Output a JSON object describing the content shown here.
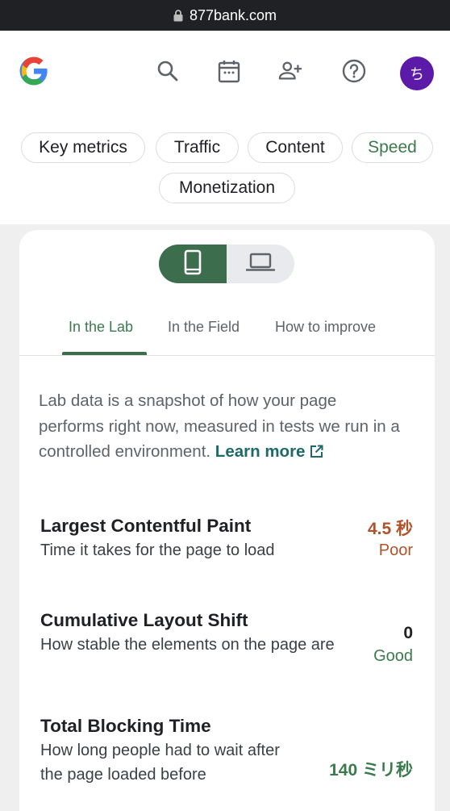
{
  "browser": {
    "url": "877bank.com",
    "lock_icon": "lock-icon"
  },
  "header": {
    "logo": "google-logo",
    "icons": [
      "search-icon",
      "calendar-icon",
      "add-person-icon",
      "help-icon"
    ],
    "avatar_initial": "ち",
    "avatar_color": "#5c1aa8"
  },
  "chips": {
    "key_metrics": "Key metrics",
    "traffic": "Traffic",
    "content": "Content",
    "speed": "Speed",
    "monetization": "Monetization",
    "selected": "Speed"
  },
  "device_toggle": {
    "selected": "mobile",
    "options": [
      "mobile",
      "desktop"
    ]
  },
  "tabs": {
    "lab": "In the Lab",
    "field": "In the Field",
    "improve": "How to improve",
    "selected": "In the Lab"
  },
  "description": {
    "text": "Lab data is a snapshot of how your page performs right now, measured in tests we run in a controlled environment.",
    "link": "Learn more"
  },
  "metrics": [
    {
      "title": "Largest Contentful Paint",
      "description": "Time it takes for the page to load",
      "value": "4.5 秒",
      "rating": "Poor"
    },
    {
      "title": "Cumulative Layout Shift",
      "description": "How stable the elements on the page are",
      "value": "0",
      "rating": "Good"
    },
    {
      "title": "Total Blocking Time",
      "description": "How long people had to wait after the page loaded before",
      "value": "140 ミリ秒",
      "rating": ""
    }
  ],
  "colors": {
    "accent_green": "#3c6e4d",
    "poor": "#b0532a",
    "good": "#3b7a4e",
    "link": "#1e6a6a"
  }
}
